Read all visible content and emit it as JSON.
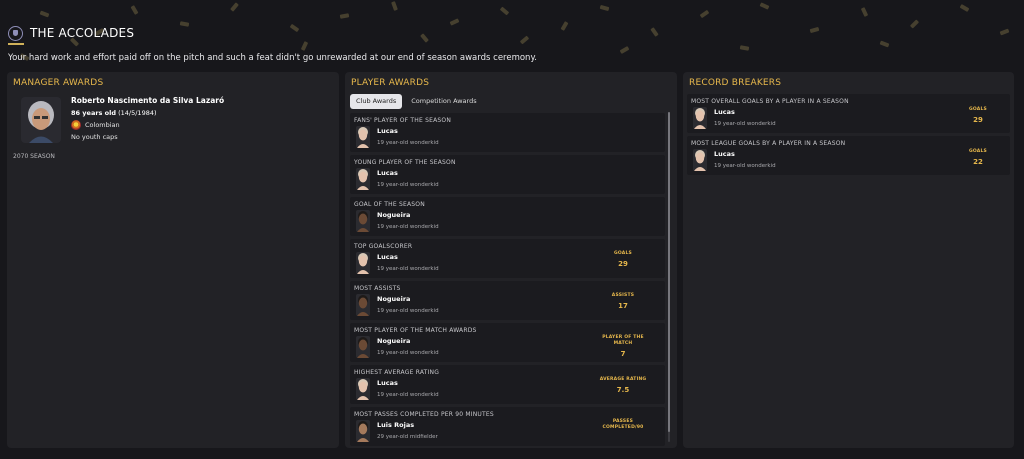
{
  "header": {
    "title": "THE ACCOLADES",
    "logo_icon": "club-crest-icon",
    "subtitle": "Your hard work and effort paid off on the pitch and such a feat didn't go unrewarded at our end of season awards ceremony."
  },
  "colors": {
    "accent": "#e7b84c",
    "background": "#17171b",
    "panel": "#222226",
    "card": "#1b1b1f"
  },
  "manager_awards": {
    "title": "MANAGER AWARDS",
    "name": "Roberto Nascimento da Silva Lazaró",
    "age_bold": "86 years old",
    "dob": "(14/5/1984)",
    "nationality": "Colombian",
    "caps": "No youth caps",
    "season": "2070 SEASON"
  },
  "player_awards": {
    "title": "PLAYER AWARDS",
    "tabs": [
      "Club Awards",
      "Competition Awards"
    ],
    "items": [
      {
        "award": "FANS' PLAYER OF THE SEASON",
        "player": "Lucas",
        "desc": "19 year-old wonderkid",
        "face": "light",
        "stat_label": "",
        "stat_value": ""
      },
      {
        "award": "YOUNG PLAYER OF THE SEASON",
        "player": "Lucas",
        "desc": "19 year-old wonderkid",
        "face": "light",
        "stat_label": "",
        "stat_value": ""
      },
      {
        "award": "GOAL OF THE SEASON",
        "player": "Nogueira",
        "desc": "19 year-old wonderkid",
        "face": "dark",
        "stat_label": "",
        "stat_value": ""
      },
      {
        "award": "TOP GOALSCORER",
        "player": "Lucas",
        "desc": "19 year-old wonderkid",
        "face": "light",
        "stat_label": "GOALS",
        "stat_value": "29"
      },
      {
        "award": "MOST ASSISTS",
        "player": "Nogueira",
        "desc": "19 year-old wonderkid",
        "face": "dark",
        "stat_label": "ASSISTS",
        "stat_value": "17"
      },
      {
        "award": "MOST PLAYER OF THE MATCH AWARDS",
        "player": "Nogueira",
        "desc": "19 year-old wonderkid",
        "face": "dark",
        "stat_label": "PLAYER OF THE MATCH",
        "stat_value": "7"
      },
      {
        "award": "HIGHEST AVERAGE RATING",
        "player": "Lucas",
        "desc": "19 year-old wonderkid",
        "face": "light",
        "stat_label": "AVERAGE RATING",
        "stat_value": "7.5"
      },
      {
        "award": "MOST PASSES COMPLETED PER 90 MINUTES",
        "player": "Luis Rojas",
        "desc": "29 year-old midfielder",
        "face": "medium",
        "stat_label": "PASSES COMPLETED/90",
        "stat_value": ""
      }
    ]
  },
  "record_breakers": {
    "title": "RECORD BREAKERS",
    "items": [
      {
        "award": "MOST OVERALL GOALS BY A PLAYER IN A SEASON",
        "player": "Lucas",
        "desc": "19 year-old wonderkid",
        "face": "light",
        "stat_label": "GOALS",
        "stat_value": "29"
      },
      {
        "award": "MOST LEAGUE GOALS BY A PLAYER IN A SEASON",
        "player": "Lucas",
        "desc": "19 year-old wonderkid",
        "face": "light",
        "stat_label": "GOALS",
        "stat_value": "22"
      }
    ]
  }
}
